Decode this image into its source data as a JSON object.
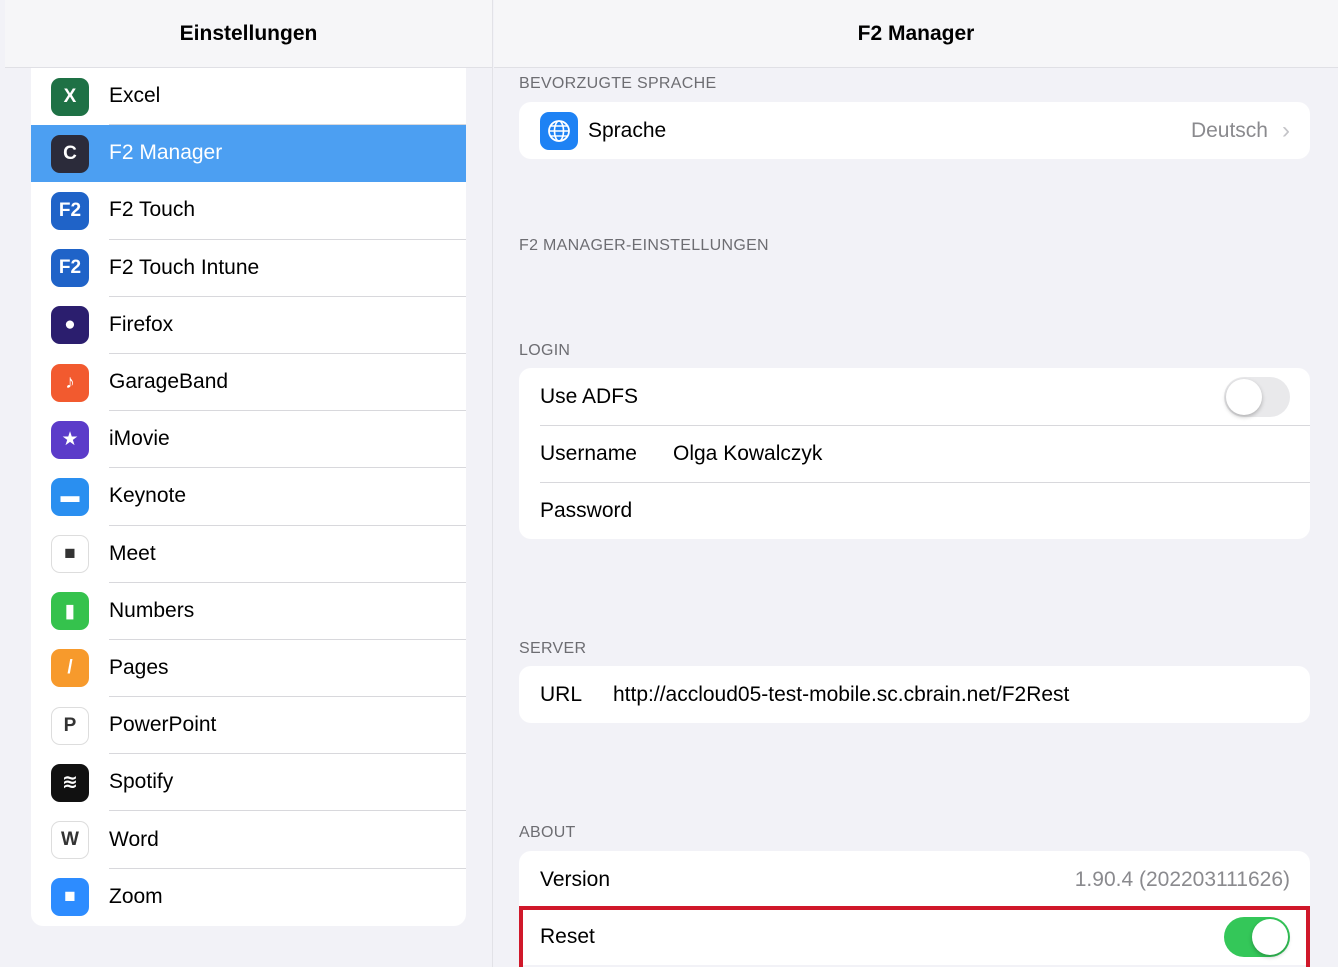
{
  "sidebar": {
    "title": "Einstellungen",
    "items": [
      {
        "label": "Excel",
        "icon": "excel-icon",
        "color": "#1e7145",
        "glyph": "X"
      },
      {
        "label": "F2 Manager",
        "icon": "f2-manager-icon",
        "color": "#2b2b3a",
        "glyph": "C"
      },
      {
        "label": "F2 Touch",
        "icon": "f2-touch-icon",
        "color": "#1f63c8",
        "glyph": "F2"
      },
      {
        "label": "F2 Touch Intune",
        "icon": "f2-touch-intune-icon",
        "color": "#1f63c8",
        "glyph": "F2"
      },
      {
        "label": "Firefox",
        "icon": "firefox-icon",
        "color": "#2b1e6e",
        "glyph": "●"
      },
      {
        "label": "GarageBand",
        "icon": "garageband-icon",
        "color": "#f25a2f",
        "glyph": "♪"
      },
      {
        "label": "iMovie",
        "icon": "imovie-icon",
        "color": "#5b3bc9",
        "glyph": "★"
      },
      {
        "label": "Keynote",
        "icon": "keynote-icon",
        "color": "#2a8ff0",
        "glyph": "▬"
      },
      {
        "label": "Meet",
        "icon": "meet-icon",
        "color": "#ffffff",
        "glyph": "■"
      },
      {
        "label": "Numbers",
        "icon": "numbers-icon",
        "color": "#35c24d",
        "glyph": "▮"
      },
      {
        "label": "Pages",
        "icon": "pages-icon",
        "color": "#f79a2c",
        "glyph": "/"
      },
      {
        "label": "PowerPoint",
        "icon": "powerpoint-icon",
        "color": "#ffffff",
        "glyph": "P"
      },
      {
        "label": "Spotify",
        "icon": "spotify-icon",
        "color": "#111111",
        "glyph": "≋"
      },
      {
        "label": "Word",
        "icon": "word-icon",
        "color": "#ffffff",
        "glyph": "W"
      },
      {
        "label": "Zoom",
        "icon": "zoom-icon",
        "color": "#2d8cff",
        "glyph": "■"
      }
    ],
    "selected_index": 1
  },
  "detail": {
    "title": "F2 Manager",
    "preferred_language": {
      "section": "BEVORZUGTE SPRACHE",
      "label": "Sprache",
      "value": "Deutsch"
    },
    "manager_settings": {
      "section": "F2 MANAGER-EINSTELLUNGEN"
    },
    "login": {
      "section": "LOGIN",
      "use_adfs_label": "Use ADFS",
      "use_adfs_on": false,
      "username_label": "Username",
      "username_value": "Olga Kowalczyk",
      "password_label": "Password"
    },
    "server": {
      "section": "SERVER",
      "url_label": "URL",
      "url_value": "http://accloud05-test-mobile.sc.cbrain.net/F2Rest"
    },
    "about": {
      "section": "ABOUT",
      "version_label": "Version",
      "version_value": "1.90.4 (202203111626)",
      "reset_label": "Reset",
      "reset_on": true
    }
  },
  "colors": {
    "selection": "#4c9ff2",
    "toggle_on": "#34c759",
    "highlight_border": "#d0182a"
  }
}
